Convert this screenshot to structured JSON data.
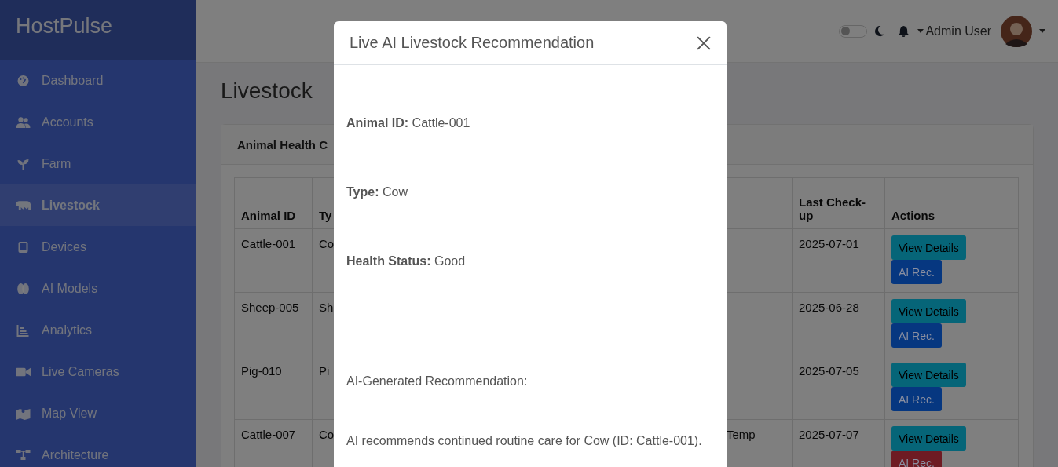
{
  "brand": "HostPulse",
  "sidebar": {
    "items": [
      {
        "label": "Dashboard",
        "selected": false
      },
      {
        "label": "Accounts",
        "selected": false
      },
      {
        "label": "Farm",
        "selected": false
      },
      {
        "label": "Livestock",
        "selected": true
      },
      {
        "label": "Devices",
        "selected": false
      },
      {
        "label": "AI Models",
        "selected": false
      },
      {
        "label": "Analytics",
        "selected": false
      },
      {
        "label": "Live Cameras",
        "selected": false
      },
      {
        "label": "Map View",
        "selected": false
      },
      {
        "label": "Architecture",
        "selected": false
      }
    ]
  },
  "topbar": {
    "dark_mode": {
      "on": false
    },
    "user": "Admin User"
  },
  "page_title": "Livestock",
  "card": {
    "title": "Animal Health C",
    "table": {
      "columns": [
        "Animal ID",
        "Ty",
        "Last Check-up",
        "Actions"
      ],
      "rows": [
        {
          "animal_id": "Cattle-001",
          "type": "Co",
          "last_checkup": "2025-07-01",
          "actions": [
            "View Details",
            "AI Rec."
          ],
          "color": "#063780"
        },
        {
          "animal_id": "Sheep-005",
          "type": "Sh",
          "last_checkup": "2025-06-28",
          "actions": [
            "View Details",
            "AI Rec."
          ],
          "color": "#063780"
        },
        {
          "animal_id": "Pig-010",
          "type": "Pi",
          "last_checkup": "2025-07-05",
          "actions": [
            "View Details",
            "AI Rec."
          ],
          "color": "#063780"
        },
        {
          "animal_id": "Cattle-007",
          "type": "Co",
          "column_4": "Temp",
          "last_checkup": "2025-07-07",
          "actions": [
            "View Details",
            "AI Rec."
          ],
          "color": "#6e1b23"
        }
      ]
    }
  },
  "modal": {
    "title": "Live AI Livestock Recommendation",
    "fields": [
      "**Animal ID:** Cattle-001",
      "**Type:** Cow",
      "**Health Status:** Good"
    ],
    "section_label": "AI-Generated Recommendation:",
    "recommendation": "AI recommends continued routine care for Cow (ID: Cattle-001)."
  }
}
